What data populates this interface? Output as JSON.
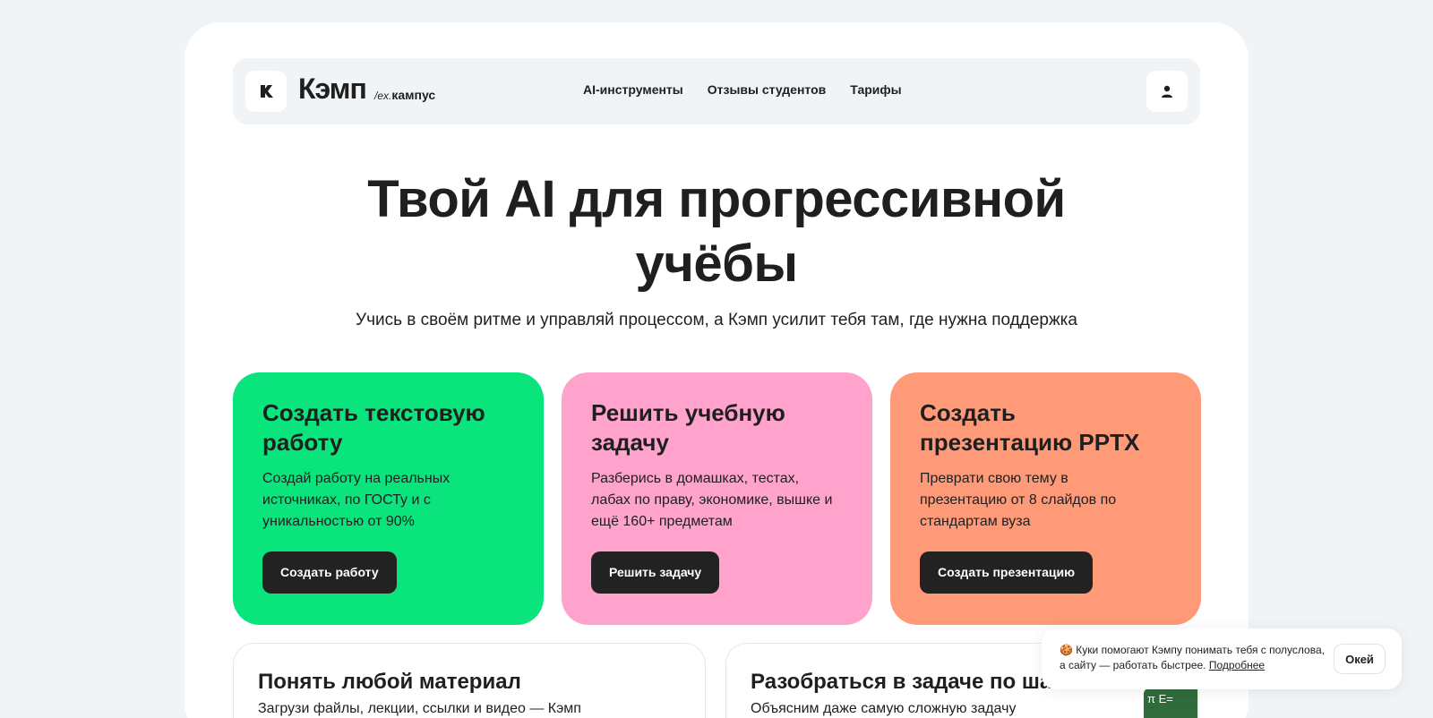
{
  "header": {
    "brand_name": "Кэмп",
    "brand_ex_prefix": "/ex.",
    "brand_ex_name": "кампус",
    "nav": [
      "AI-инструменты",
      "Отзывы студентов",
      "Тарифы"
    ],
    "icons": {
      "logo": "k-logo-icon",
      "user": "user-icon"
    }
  },
  "hero": {
    "title_line1": "Твой AI для прогрессивной",
    "title_line2": "учёбы",
    "subtitle": "Учись в своём ритме и управляй процессом, а Кэмп усилит тебя там, где нужна поддержка"
  },
  "cards": [
    {
      "title": "Создать текстовую работу",
      "text": "Создай работу на реальных источниках, по ГОСТу и с уникальностью от 90%",
      "button": "Создать работу",
      "color": "#0ae47d"
    },
    {
      "title": "Решить учебную задачу",
      "text": "Разберись в домашках, тестах, лабах по праву, экономике, вышке и ещё 160+ предметам",
      "button": "Решить задачу",
      "color": "#ffa3cc"
    },
    {
      "title": "Создать презентацию PPTX",
      "text": "Преврати свою тему в презентацию от 8 слайдов по стандартам вуза",
      "button": "Создать презентацию",
      "color": "#ff9a78"
    }
  ],
  "features": [
    {
      "title": "Понять любой материал",
      "text": "Загрузи файлы, лекции, ссылки и видео — Кэмп"
    },
    {
      "title": "Разобраться в задаче по шагам",
      "text": "Объясним даже самую сложную задачу"
    }
  ],
  "cookie": {
    "emoji": "🍪",
    "text": "Куки помогают Кэмпу понимать тебя с полуслова, а сайту — работать быстрее.",
    "link": "Подробнее",
    "ok": "Окей"
  }
}
